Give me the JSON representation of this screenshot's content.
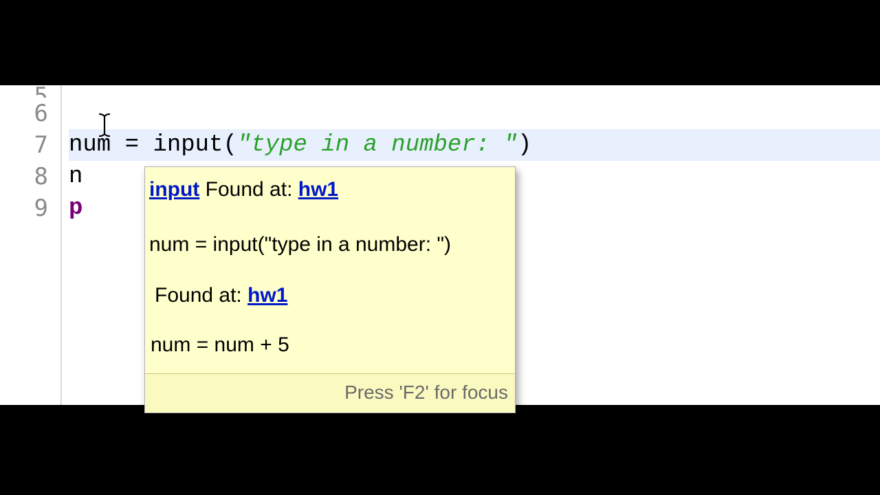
{
  "gutter": {
    "line_partial_top": "5",
    "lines": [
      "6",
      "7",
      "8",
      "9"
    ]
  },
  "code": {
    "line6": "",
    "line7": {
      "var": "num",
      "op": " = ",
      "fn": "input",
      "open": "(",
      "str": "\"type in a number: \"",
      "close": ")"
    },
    "line8_frag": "n",
    "line9_frag": "p"
  },
  "tooltip": {
    "row1_link": "input",
    "row1_text": " Found at: ",
    "row1_loc": "hw1",
    "row1_code": "num = input(\"type in a number: \")",
    "row2_text": "Found at: ",
    "row2_loc": "hw1",
    "row2_code": "num = num + 5",
    "hint": "Press 'F2' for focus"
  }
}
